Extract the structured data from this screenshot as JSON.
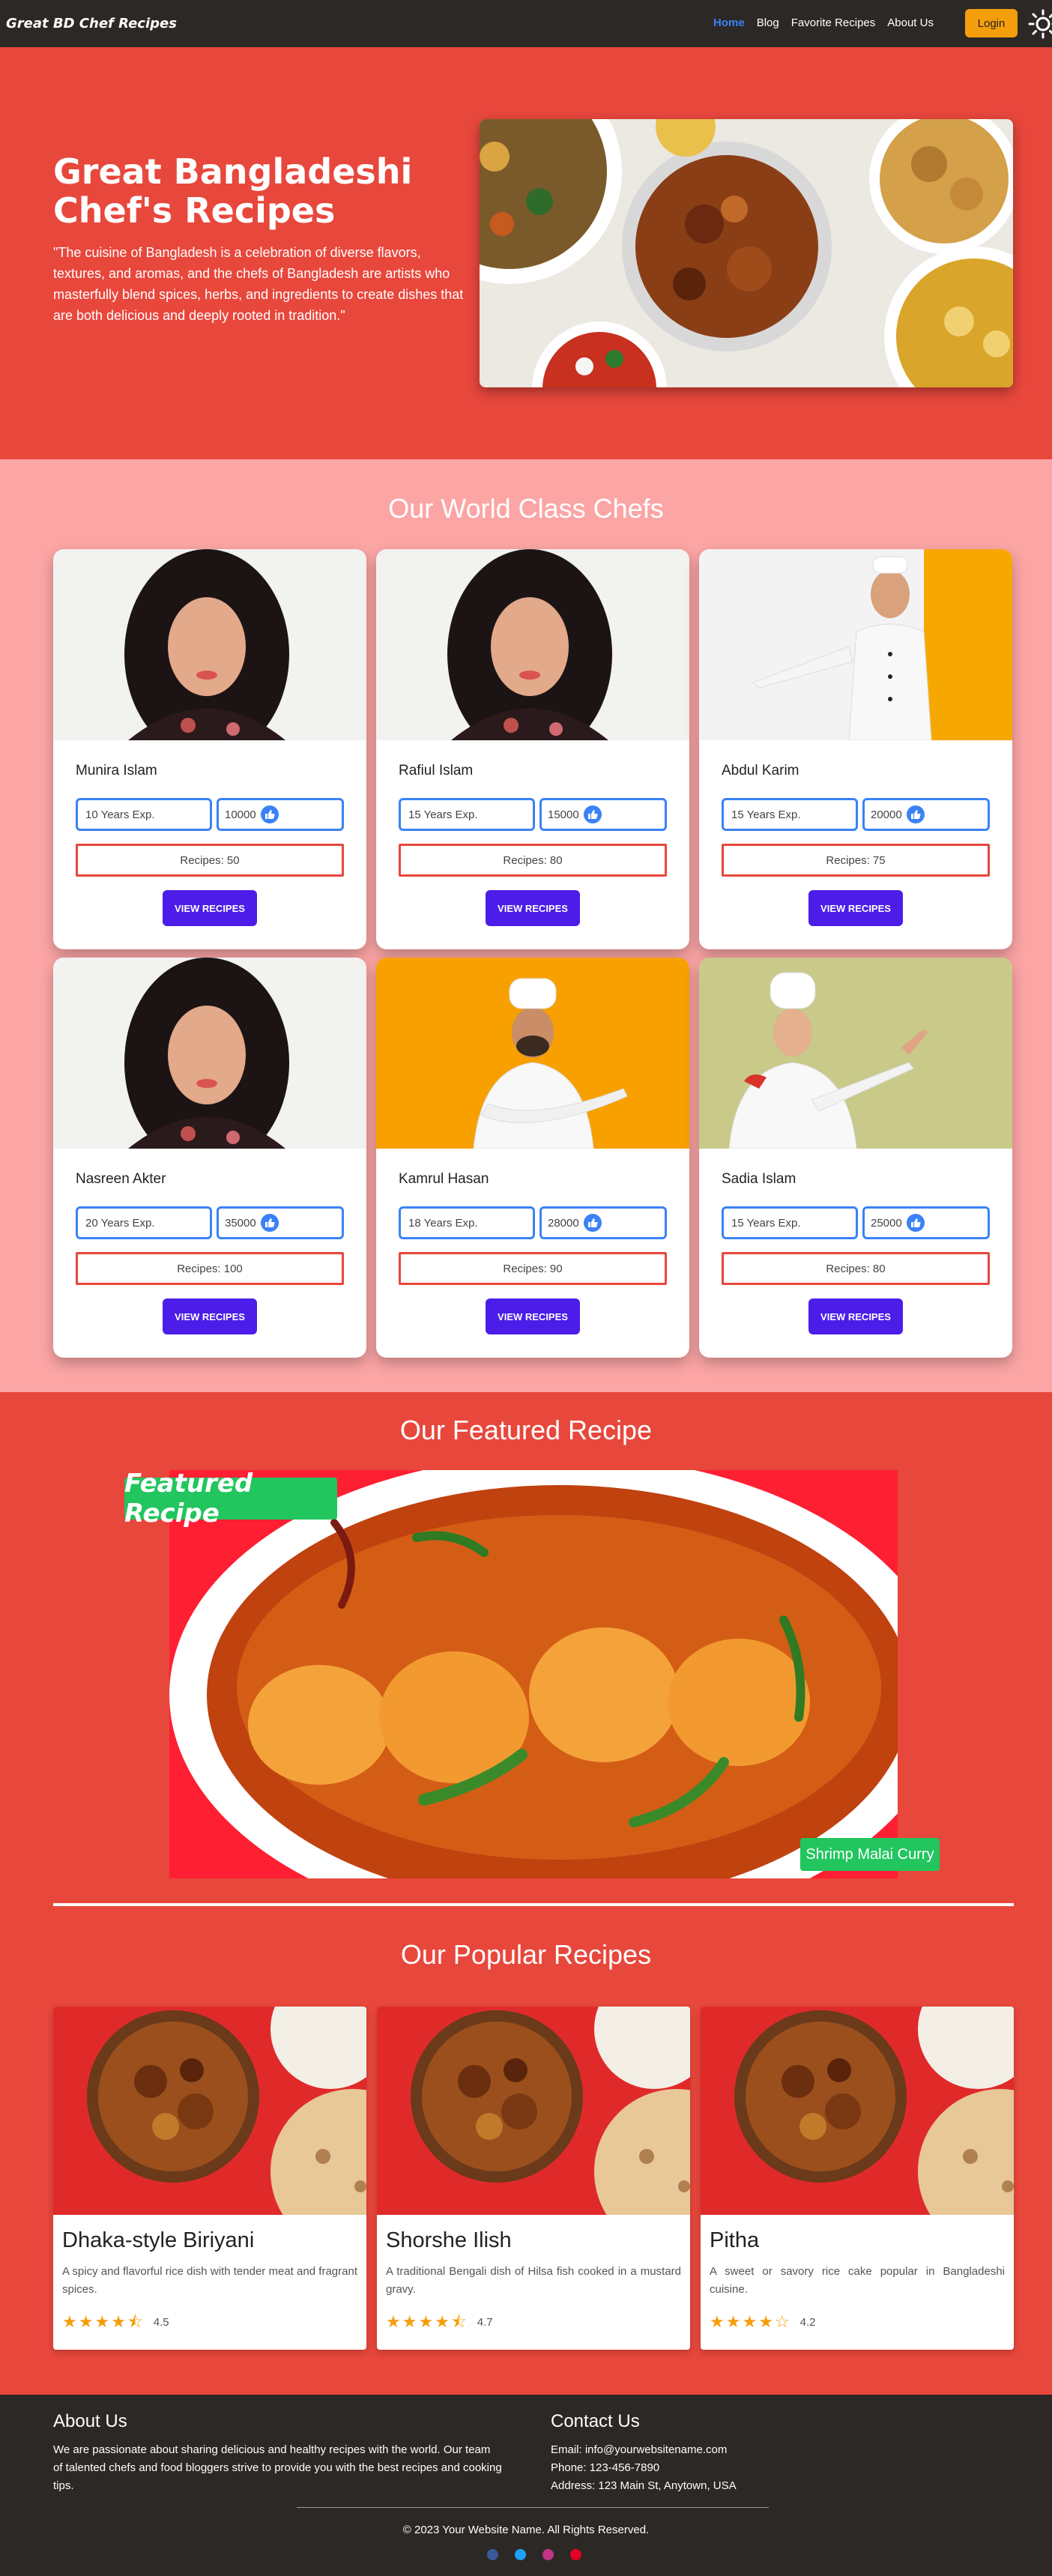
{
  "nav": {
    "brand": "Great BD Chef Recipes",
    "links": [
      "Home",
      "Blog",
      "Favorite Recipes",
      "About Us"
    ],
    "login": "Login"
  },
  "hero": {
    "title": "Great Bangladeshi Chef's Recipes",
    "text": "\"The cuisine of Bangladesh is a celebration of diverse flavors, textures, and aromas, and the chefs of Bangladesh are artists who masterfully blend spices, herbs, and ingredients to create dishes that are both delicious and deeply rooted in tradition.\""
  },
  "chefs_section": {
    "title": "Our World Class Chefs",
    "button_label": "VIEW RECIPES",
    "chefs": [
      {
        "name": "Munira Islam",
        "experience": "10 Years Exp.",
        "likes": "10000",
        "recipes": "Recipes: 50"
      },
      {
        "name": "Rafiul Islam",
        "experience": "15 Years Exp.",
        "likes": "15000",
        "recipes": "Recipes: 80"
      },
      {
        "name": "Abdul Karim",
        "experience": "15 Years Exp.",
        "likes": "20000",
        "recipes": "Recipes: 75"
      },
      {
        "name": "Nasreen Akter",
        "experience": "20 Years Exp.",
        "likes": "35000",
        "recipes": "Recipes: 100"
      },
      {
        "name": "Kamrul Hasan",
        "experience": "18 Years Exp.",
        "likes": "28000",
        "recipes": "Recipes: 90"
      },
      {
        "name": "Sadia Islam",
        "experience": "15 Years Exp.",
        "likes": "25000",
        "recipes": "Recipes: 80"
      }
    ]
  },
  "featured": {
    "title": "Our Featured Recipe",
    "badge": "Featured Recipe",
    "recipe_name": "Shrimp Malai Curry"
  },
  "popular": {
    "title": "Our Popular Recipes",
    "recipes": [
      {
        "name": "Dhaka-style Biriyani",
        "description": "A spicy and flavorful rice dish with tender meat and fragrant spices.",
        "rating": "4.5"
      },
      {
        "name": "Shorshe Ilish",
        "description": "A traditional Bengali dish of Hilsa fish cooked in a mustard gravy.",
        "rating": "4.7"
      },
      {
        "name": "Pitha",
        "description": "A sweet or savory rice cake popular in Bangladeshi cuisine.",
        "rating": "4.2"
      }
    ]
  },
  "footer": {
    "about_title": "About Us",
    "about_text": "We are passionate about sharing delicious and healthy recipes with the world. Our team of talented chefs and food bloggers strive to provide you with the best recipes and cooking tips.",
    "contact_title": "Contact Us",
    "email": "Email: info@yourwebsitename.com",
    "phone": "Phone: 123-456-7890",
    "address": "Address: 123 Main St, Anytown, USA",
    "copyright": "© 2023 Your Website Name. All Rights Reserved."
  },
  "colors": {
    "primary_red": "#e8473c",
    "pink": "#fca5a5",
    "dark": "#2c2826",
    "button_purple": "#4c1de8",
    "badge_green": "#22c55e",
    "link_blue": "#3b82f6",
    "login_orange": "#f59e0b"
  }
}
